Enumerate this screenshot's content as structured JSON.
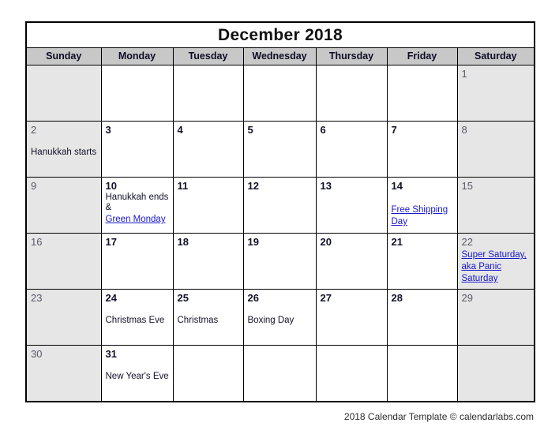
{
  "calendar": {
    "title": "December 2018",
    "weekdays": [
      "Sunday",
      "Monday",
      "Tuesday",
      "Wednesday",
      "Thursday",
      "Friday",
      "Saturday"
    ],
    "accent_link_color": "#1717cc",
    "weekend_bg_color": "#e6e6e6",
    "header_bg_color": "#c8c8c8",
    "weeks": [
      {
        "days": [
          {
            "num": "",
            "weekend": true,
            "events": []
          },
          {
            "num": "",
            "weekend": false,
            "events": []
          },
          {
            "num": "",
            "weekend": false,
            "events": []
          },
          {
            "num": "",
            "weekend": false,
            "events": []
          },
          {
            "num": "",
            "weekend": false,
            "events": []
          },
          {
            "num": "",
            "weekend": false,
            "events": []
          },
          {
            "num": "1",
            "weekend": true,
            "events": []
          }
        ]
      },
      {
        "days": [
          {
            "num": "2",
            "weekend": true,
            "gap": true,
            "events": [
              {
                "text": "Hanukkah starts",
                "link": false
              }
            ]
          },
          {
            "num": "3",
            "weekend": false,
            "events": []
          },
          {
            "num": "4",
            "weekend": false,
            "events": []
          },
          {
            "num": "5",
            "weekend": false,
            "events": []
          },
          {
            "num": "6",
            "weekend": false,
            "events": []
          },
          {
            "num": "7",
            "weekend": false,
            "events": []
          },
          {
            "num": "8",
            "weekend": true,
            "events": []
          }
        ]
      },
      {
        "days": [
          {
            "num": "9",
            "weekend": true,
            "events": []
          },
          {
            "num": "10",
            "weekend": false,
            "gap": false,
            "events": [
              {
                "text": "Hanukkah ends & ",
                "link": false
              },
              {
                "text": "Green Monday",
                "link": true
              }
            ]
          },
          {
            "num": "11",
            "weekend": false,
            "events": []
          },
          {
            "num": "12",
            "weekend": false,
            "events": []
          },
          {
            "num": "13",
            "weekend": false,
            "events": []
          },
          {
            "num": "14",
            "weekend": false,
            "gap": true,
            "events": [
              {
                "text": "Free Shipping Day",
                "link": true
              }
            ]
          },
          {
            "num": "15",
            "weekend": true,
            "events": []
          }
        ]
      },
      {
        "days": [
          {
            "num": "16",
            "weekend": true,
            "events": []
          },
          {
            "num": "17",
            "weekend": false,
            "events": []
          },
          {
            "num": "18",
            "weekend": false,
            "events": []
          },
          {
            "num": "19",
            "weekend": false,
            "events": []
          },
          {
            "num": "20",
            "weekend": false,
            "events": []
          },
          {
            "num": "21",
            "weekend": false,
            "events": []
          },
          {
            "num": "22",
            "weekend": true,
            "gap": false,
            "events": [
              {
                "text": "Super Saturday, aka Panic Saturday",
                "link": true
              }
            ]
          }
        ]
      },
      {
        "days": [
          {
            "num": "23",
            "weekend": true,
            "events": []
          },
          {
            "num": "24",
            "weekend": false,
            "gap": true,
            "events": [
              {
                "text": "Christmas Eve",
                "link": false
              }
            ]
          },
          {
            "num": "25",
            "weekend": false,
            "gap": true,
            "events": [
              {
                "text": "Christmas",
                "link": false
              }
            ]
          },
          {
            "num": "26",
            "weekend": false,
            "gap": true,
            "events": [
              {
                "text": "Boxing Day",
                "link": false
              }
            ]
          },
          {
            "num": "27",
            "weekend": false,
            "events": []
          },
          {
            "num": "28",
            "weekend": false,
            "events": []
          },
          {
            "num": "29",
            "weekend": true,
            "events": []
          }
        ]
      },
      {
        "days": [
          {
            "num": "30",
            "weekend": true,
            "events": []
          },
          {
            "num": "31",
            "weekend": false,
            "gap": true,
            "events": [
              {
                "text": "New Year's Eve",
                "link": false
              }
            ]
          },
          {
            "num": "",
            "weekend": false,
            "events": []
          },
          {
            "num": "",
            "weekend": false,
            "events": []
          },
          {
            "num": "",
            "weekend": false,
            "events": []
          },
          {
            "num": "",
            "weekend": false,
            "events": []
          },
          {
            "num": "",
            "weekend": true,
            "events": []
          }
        ]
      }
    ]
  },
  "footer": {
    "text": "2018 Calendar Template © calendarlabs.com"
  }
}
